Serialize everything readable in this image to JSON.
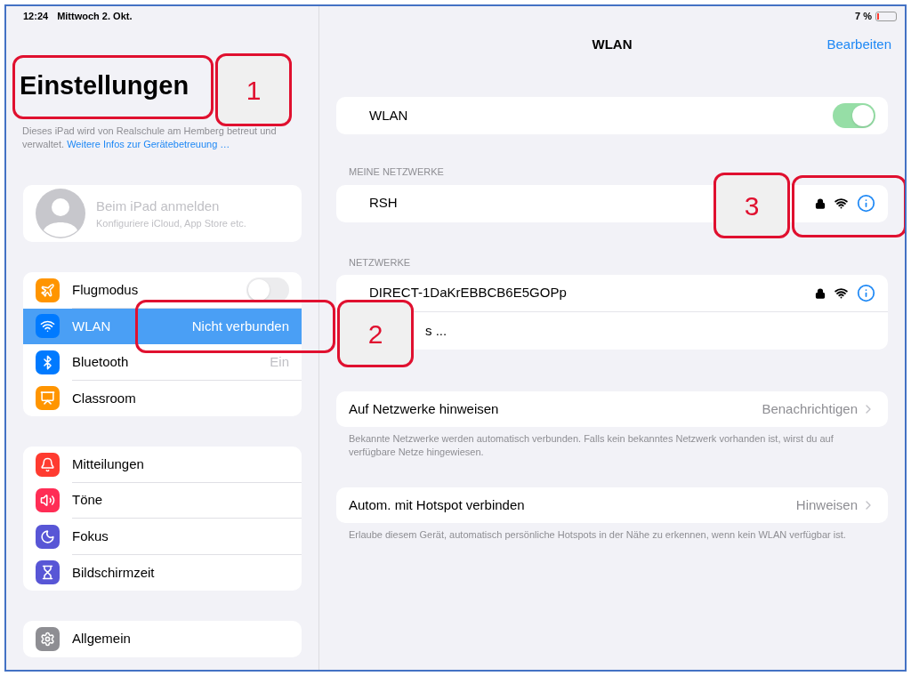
{
  "status_bar": {
    "time": "12:24",
    "date": "Mittwoch 2. Okt.",
    "battery": "7 %"
  },
  "sidebar": {
    "title": "Einstellungen",
    "managed_note": "Dieses iPad wird von Realschule am Hemberg betreut und verwaltet.",
    "managed_link": "Weitere Infos zur Gerätebetreuung …",
    "account": {
      "title": "Beim iPad anmelden",
      "subtitle": "Konfiguriere iCloud, App Store etc."
    },
    "groups": [
      [
        {
          "label": "Flugmodus",
          "color": "#ff9500",
          "kind": "toggle",
          "on": false,
          "selected": false
        },
        {
          "label": "WLAN",
          "color": "#007aff",
          "kind": "value",
          "value": "Nicht verbunden",
          "selected": true
        },
        {
          "label": "Bluetooth",
          "color": "#007aff",
          "kind": "value",
          "value": "Ein",
          "selected": false
        },
        {
          "label": "Classroom",
          "color": "#ff9500",
          "kind": "plain",
          "selected": false
        }
      ],
      [
        {
          "label": "Mitteilungen",
          "color": "#ff3b30",
          "kind": "plain",
          "selected": false
        },
        {
          "label": "Töne",
          "color": "#ff2d55",
          "kind": "plain",
          "selected": false
        },
        {
          "label": "Fokus",
          "color": "#5856d6",
          "kind": "plain",
          "selected": false
        },
        {
          "label": "Bildschirmzeit",
          "color": "#5856d6",
          "kind": "plain",
          "selected": false
        }
      ],
      [
        {
          "label": "Allgemein",
          "color": "#8e8e93",
          "kind": "plain",
          "selected": false
        }
      ]
    ]
  },
  "main": {
    "title": "WLAN",
    "edit": "Bearbeiten",
    "wlan": {
      "label": "WLAN",
      "on": true
    },
    "my_networks": {
      "header": "MEINE NETZWERKE",
      "networks": [
        {
          "name": "RSH",
          "locked": true
        }
      ]
    },
    "networks": {
      "header": "NETZWERKE",
      "networks": [
        {
          "name": "DIRECT-1DaKrEBBCB6E5GOPp",
          "locked": true
        }
      ],
      "other": "s ..."
    },
    "settings": [
      {
        "label": "Auf Netzwerke hinweisen",
        "value": "Benachrichtigen",
        "footer": "Bekannte Netzwerke werden automatisch verbunden. Falls kein bekanntes Netzwerk vorhanden ist, wirst du auf verfügbare Netze hingewiesen."
      },
      {
        "label": "Autom. mit Hotspot verbinden",
        "value": "Hinweisen",
        "footer": "Erlaube diesem Gerät, automatisch persönliche Hotspots in der Nähe zu erkennen, wenn kein WLAN verfügbar ist."
      }
    ]
  },
  "callouts": [
    {
      "number": "1"
    },
    {
      "number": "2"
    },
    {
      "number": "3"
    }
  ]
}
